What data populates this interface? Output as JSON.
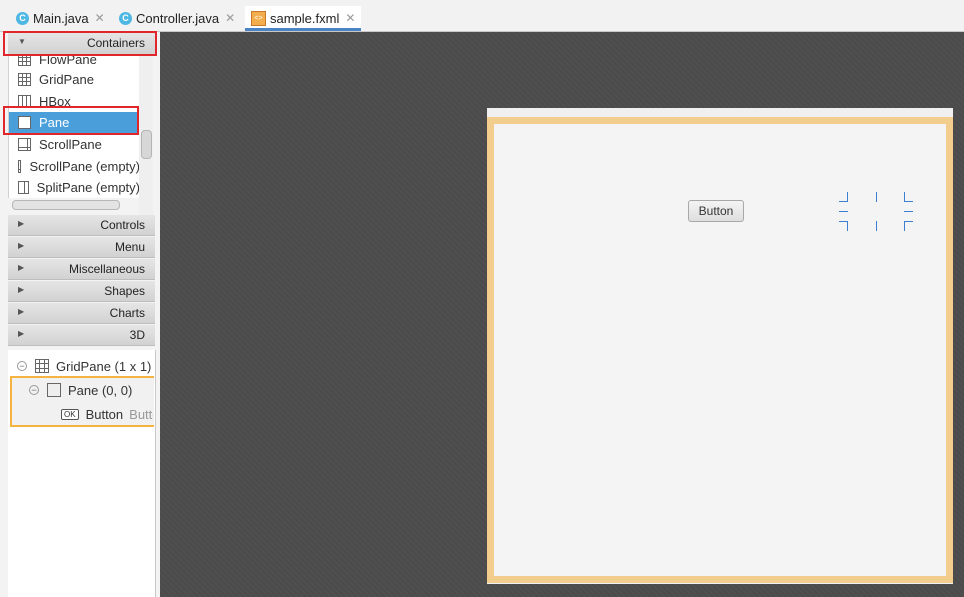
{
  "tabs": [
    {
      "label": "Main.java",
      "icon": "java-class-icon"
    },
    {
      "label": "Controller.java",
      "icon": "java-class-icon"
    },
    {
      "label": "sample.fxml",
      "icon": "fxml-file-icon",
      "active": true
    }
  ],
  "library": {
    "sections": [
      {
        "label": "Containers",
        "expanded": true
      },
      {
        "label": "Controls"
      },
      {
        "label": "Menu"
      },
      {
        "label": "Miscellaneous"
      },
      {
        "label": "Shapes"
      },
      {
        "label": "Charts"
      },
      {
        "label": "3D"
      }
    ],
    "containers_items": [
      {
        "label": "FlowPane",
        "icon": "flowpane-icon"
      },
      {
        "label": "GridPane",
        "icon": "gridpane-icon"
      },
      {
        "label": "HBox",
        "icon": "hbox-icon"
      },
      {
        "label": "Pane",
        "icon": "pane-icon",
        "selected": true
      },
      {
        "label": "ScrollPane",
        "icon": "scrollpane-icon"
      },
      {
        "label": "ScrollPane  (empty)",
        "icon": "scrollpane-icon"
      },
      {
        "label": "SplitPane  (empty)",
        "icon": "splitpane-icon"
      }
    ]
  },
  "hierarchy": [
    {
      "label": "GridPane (1 x 1)",
      "level": 0,
      "icon": "gridpane-icon"
    },
    {
      "label": "Pane (0, 0)",
      "level": 1,
      "icon": "pane-icon"
    },
    {
      "label": "Button",
      "secondary": "Button",
      "level": 2,
      "icon": "ok-button-icon"
    }
  ],
  "canvas": {
    "button_label": "Button"
  },
  "colors": {
    "highlight": "#e0262b",
    "selection": "#4a9fdb",
    "stage_border": "#f2cd8e",
    "hierarchy_selection": "#f5b340"
  }
}
